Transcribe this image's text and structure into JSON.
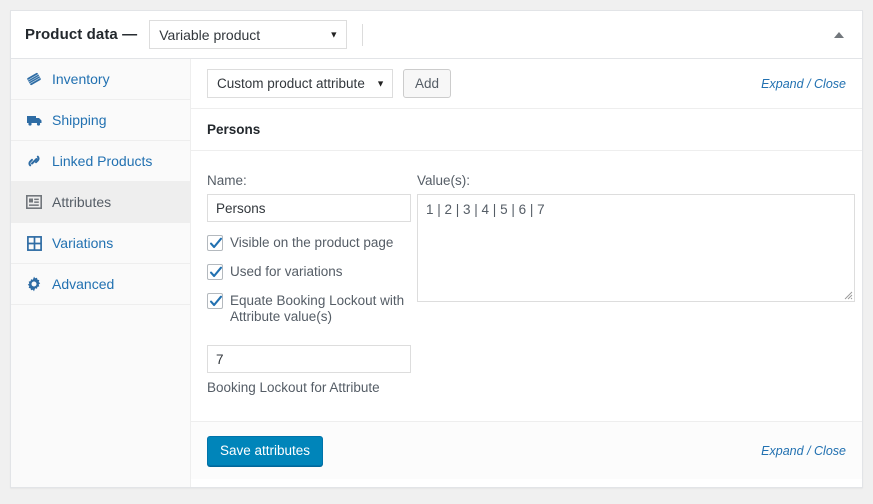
{
  "header": {
    "title": "Product data —",
    "product_type": {
      "selected": "Variable product",
      "caret": "▼"
    },
    "collapse_icon": "chevron-up-icon"
  },
  "sidebar": {
    "items": [
      {
        "label": "Inventory",
        "icon": "inventory-box-icon",
        "active": false
      },
      {
        "label": "Shipping",
        "icon": "truck-icon",
        "active": false
      },
      {
        "label": "Linked Products",
        "icon": "link-chain-icon",
        "active": false
      },
      {
        "label": "Attributes",
        "icon": "attributes-panel-icon",
        "active": true
      },
      {
        "label": "Variations",
        "icon": "grid-table-icon",
        "active": false
      },
      {
        "label": "Advanced",
        "icon": "gear-icon",
        "active": false
      }
    ]
  },
  "toolbar": {
    "attribute_select": {
      "selected": "Custom product attribute",
      "caret": "▼"
    },
    "add_label": "Add",
    "expand_label": "Expand",
    "separator": "/",
    "close_label": "Close"
  },
  "attribute": {
    "group_title": "Persons",
    "name_label": "Name:",
    "name_value": "Persons",
    "values_label": "Value(s):",
    "values_value": "1 | 2 | 3 | 4 | 5 | 6 | 7",
    "checkboxes": [
      {
        "label": "Visible on the product page",
        "checked": true
      },
      {
        "label": "Used for variations",
        "checked": true
      },
      {
        "label": "Equate Booking Lockout with Attribute value(s)",
        "checked": true
      }
    ],
    "lockout_value": "7",
    "lockout_help": "Booking Lockout for Attribute"
  },
  "footer": {
    "save_label": "Save attributes",
    "expand_label": "Expand",
    "separator": "/",
    "close_label": "Close"
  },
  "colors": {
    "accent_link": "#2271b1",
    "primary_button": "#0085ba",
    "active_tab_bg": "#eeeeee",
    "page_bg": "#f0f0f0",
    "panel_border": "#e2e4e7",
    "checkbox_check": "#2271b1"
  }
}
